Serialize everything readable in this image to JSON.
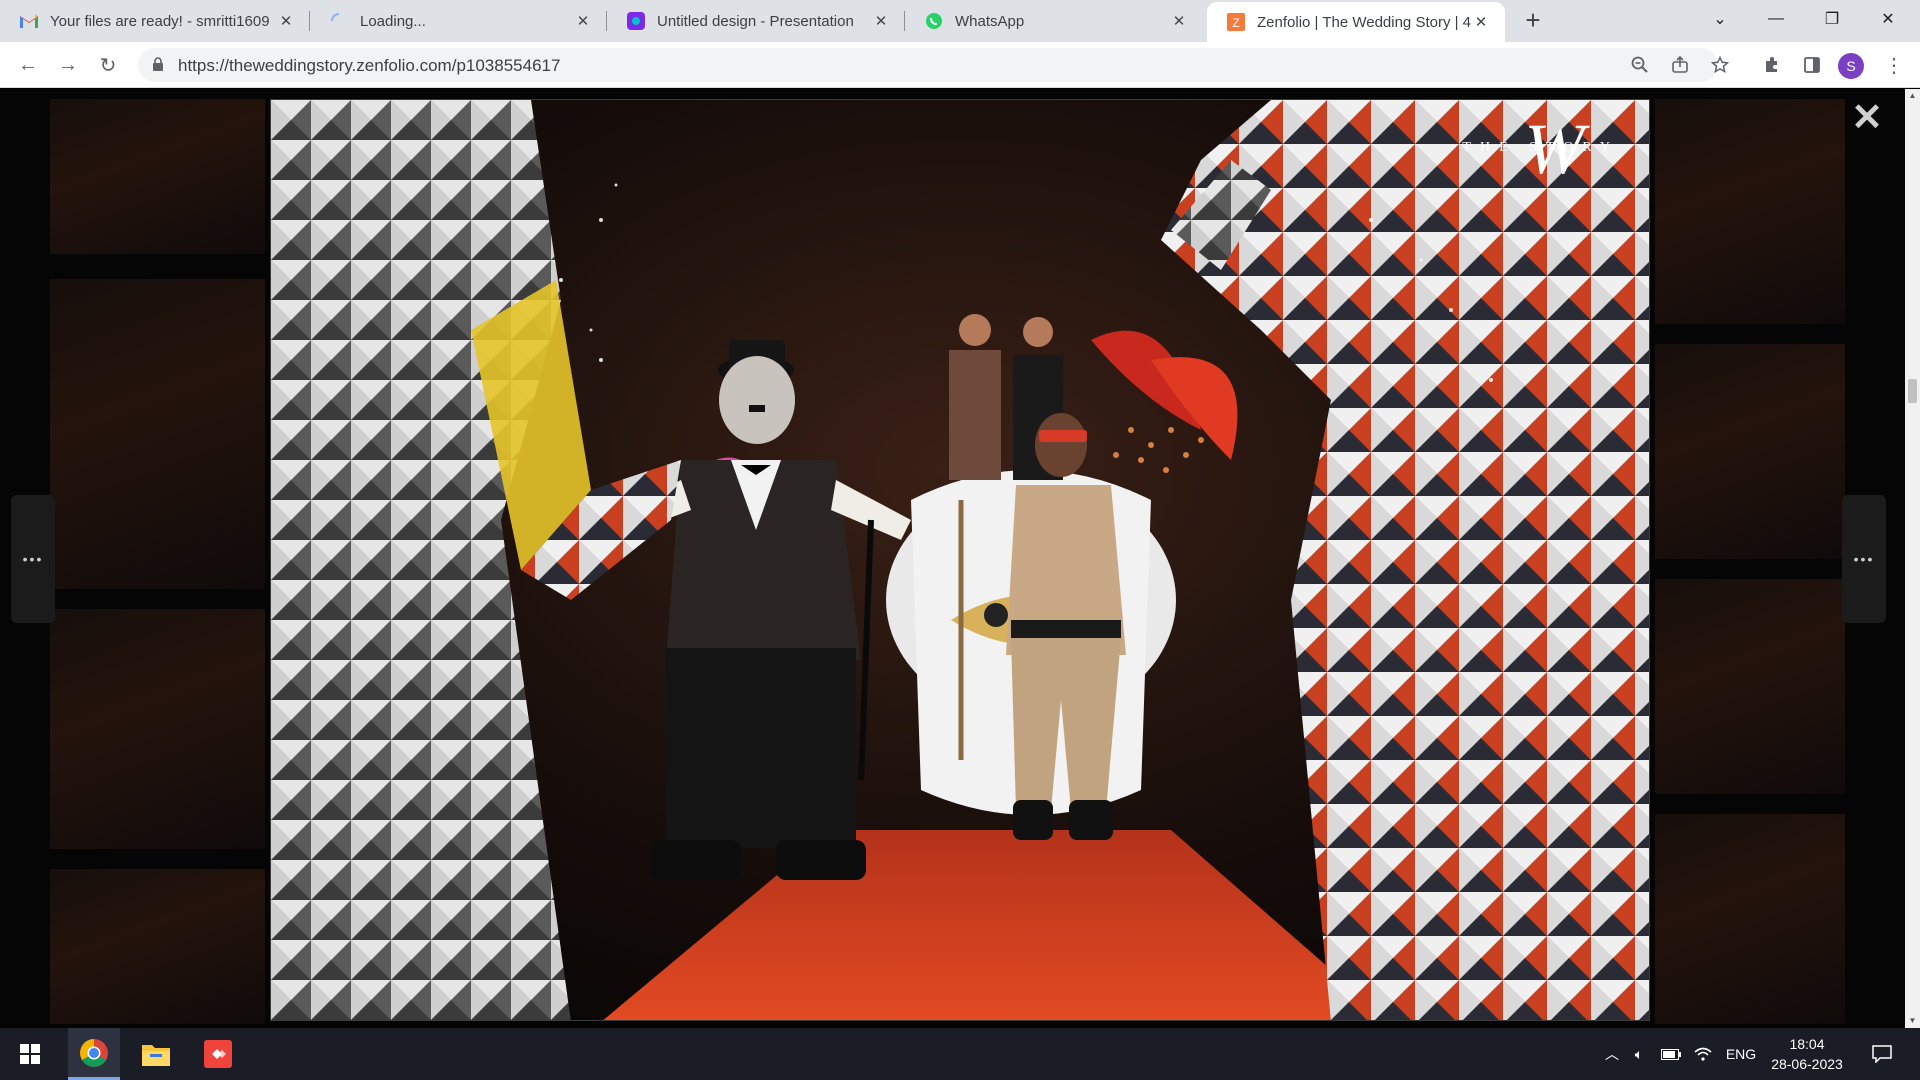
{
  "browser": {
    "tabs": [
      {
        "title": "Your files are ready! - smritti1609",
        "icon": "gmail-icon",
        "active": false
      },
      {
        "title": "Loading...",
        "icon": "loading-spinner-icon",
        "active": false
      },
      {
        "title": "Untitled design - Presentation",
        "icon": "canva-icon",
        "active": false
      },
      {
        "title": "WhatsApp",
        "icon": "whatsapp-icon",
        "active": false
      },
      {
        "title": "Zenfolio | The Wedding Story | 4",
        "icon": "zenfolio-icon",
        "active": true
      }
    ],
    "new_tab_label": "+",
    "url": "https://theweddingstory.zenfolio.com/p1038554617",
    "profile_initial": "S",
    "profile_color": "#7b3fc4"
  },
  "lightbox": {
    "watermark": "THE STORY",
    "watermark_monogram": "W",
    "close_label": "✕",
    "prev_label": "•••",
    "next_label": "•••"
  },
  "taskbar": {
    "apps": [
      "windows-start-icon",
      "chrome-icon",
      "file-explorer-icon",
      "anydesk-icon"
    ],
    "tray": {
      "language": "ENG",
      "time": "18:04",
      "date": "28-06-2023"
    }
  },
  "colors": {
    "tabstrip": "#dee1e6",
    "accent": "#1a73e8",
    "taskbar": "#1a1d26",
    "carpet": "#d2401f"
  }
}
